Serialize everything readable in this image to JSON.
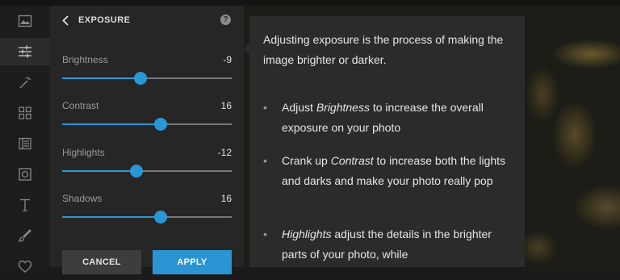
{
  "panel": {
    "title": "EXPOSURE",
    "help": "?",
    "sliders": [
      {
        "label": "Brightness",
        "value": "-9",
        "level": 0.46
      },
      {
        "label": "Contrast",
        "value": "16",
        "level": 0.58
      },
      {
        "label": "Highlights",
        "value": "-12",
        "level": 0.44
      },
      {
        "label": "Shadows",
        "value": "16",
        "level": 0.58
      }
    ],
    "cancel_label": "CANCEL",
    "apply_label": "APPLY"
  },
  "tooltip": {
    "intro": "Adjusting exposure is the process of making the image brighter or darker.",
    "bullet_mark": "•",
    "bullets": [
      {
        "pre": "Adjust ",
        "em": "Brightness",
        "post": " to increase the overall exposure on your photo"
      },
      {
        "pre": "Crank up ",
        "em": "Contrast",
        "post": " to increase both the lights and darks and make your photo really pop"
      },
      {
        "pre": "",
        "em": "Highlights",
        "post": " adjust the details in the brighter parts of your photo, while"
      }
    ]
  },
  "toolbar_icons": [
    "image-icon",
    "sliders-icon",
    "magic-wand-icon",
    "grid-icon",
    "frame-icon",
    "focus-icon",
    "text-icon",
    "brush-icon",
    "heart-icon"
  ],
  "colors": {
    "accent": "#2b95d4",
    "panel": "#262626",
    "tooltip": "#2b2b2b"
  }
}
